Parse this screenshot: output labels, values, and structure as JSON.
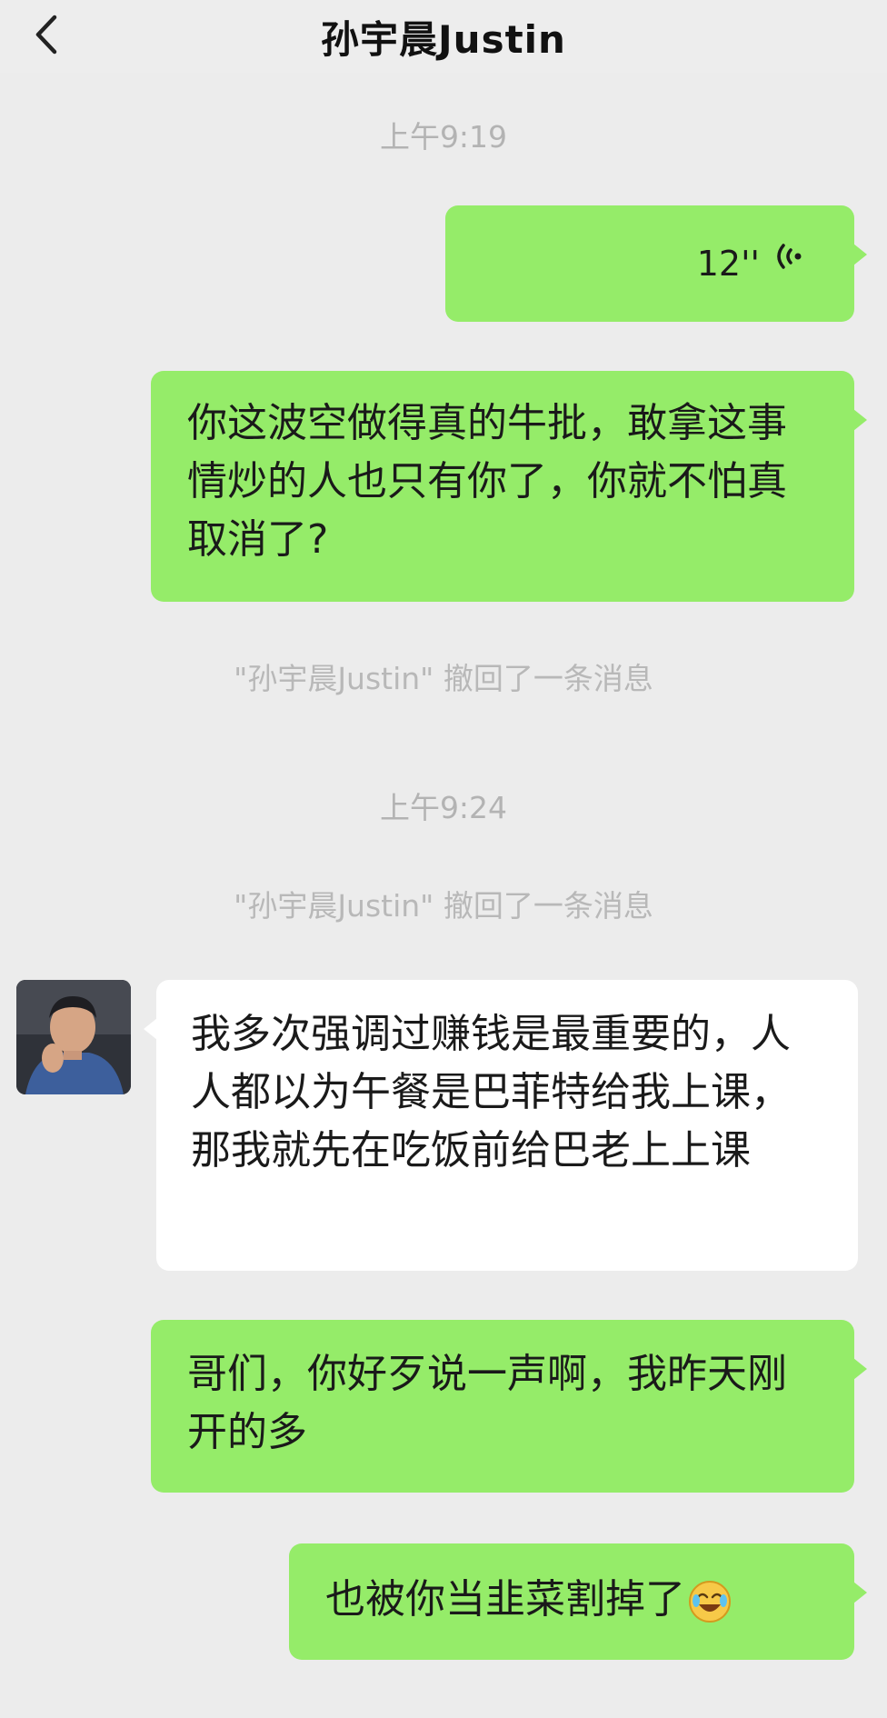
{
  "header": {
    "back_icon": "chevron-left-icon",
    "title": "孙宇晨Justin"
  },
  "messages": {
    "time_1": "上午9:19",
    "voice": {
      "duration": "12''",
      "icon": "voice-wave-icon"
    },
    "sent_1": "你这波空做得真的牛批，敢拿这事情炒的人也只有你了，你就不怕真取消了?",
    "recall_1": "\"孙宇晨Justin\" 撤回了一条消息",
    "time_2": "上午9:24",
    "recall_2": "\"孙宇晨Justin\" 撤回了一条消息",
    "received_1": "我多次强调过赚钱是最重要的，人人都以为午餐是巴菲特给我上课，那我就先在吃饭前给巴老上上课",
    "sent_2": "哥们，你好歹说一声啊，我昨天刚开的多",
    "sent_3": "也被你当韭菜割掉了",
    "sent_3_emoji": "laughing-crying-emoji"
  },
  "colors": {
    "sent_bubble": "#95ec69",
    "received_bubble": "#ffffff",
    "background": "#ececec",
    "timestamp_text": "#b3b3b3"
  }
}
